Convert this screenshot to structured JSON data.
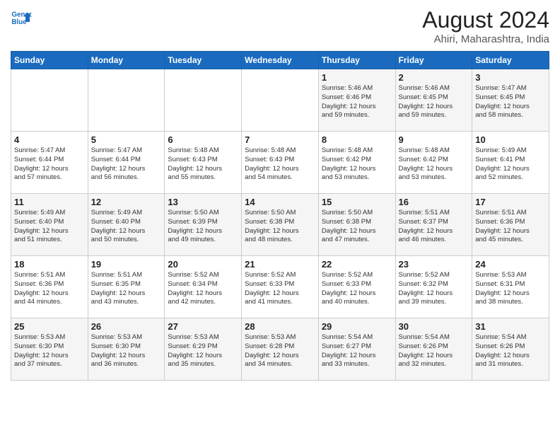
{
  "logo": {
    "line1": "General",
    "line2": "Blue"
  },
  "title": "August 2024",
  "subtitle": "Ahiri, Maharashtra, India",
  "days_of_week": [
    "Sunday",
    "Monday",
    "Tuesday",
    "Wednesday",
    "Thursday",
    "Friday",
    "Saturday"
  ],
  "weeks": [
    [
      {
        "day": "",
        "info": ""
      },
      {
        "day": "",
        "info": ""
      },
      {
        "day": "",
        "info": ""
      },
      {
        "day": "",
        "info": ""
      },
      {
        "day": "1",
        "info": "Sunrise: 5:46 AM\nSunset: 6:46 PM\nDaylight: 12 hours\nand 59 minutes."
      },
      {
        "day": "2",
        "info": "Sunrise: 5:46 AM\nSunset: 6:45 PM\nDaylight: 12 hours\nand 59 minutes."
      },
      {
        "day": "3",
        "info": "Sunrise: 5:47 AM\nSunset: 6:45 PM\nDaylight: 12 hours\nand 58 minutes."
      }
    ],
    [
      {
        "day": "4",
        "info": "Sunrise: 5:47 AM\nSunset: 6:44 PM\nDaylight: 12 hours\nand 57 minutes."
      },
      {
        "day": "5",
        "info": "Sunrise: 5:47 AM\nSunset: 6:44 PM\nDaylight: 12 hours\nand 56 minutes."
      },
      {
        "day": "6",
        "info": "Sunrise: 5:48 AM\nSunset: 6:43 PM\nDaylight: 12 hours\nand 55 minutes."
      },
      {
        "day": "7",
        "info": "Sunrise: 5:48 AM\nSunset: 6:43 PM\nDaylight: 12 hours\nand 54 minutes."
      },
      {
        "day": "8",
        "info": "Sunrise: 5:48 AM\nSunset: 6:42 PM\nDaylight: 12 hours\nand 53 minutes."
      },
      {
        "day": "9",
        "info": "Sunrise: 5:48 AM\nSunset: 6:42 PM\nDaylight: 12 hours\nand 53 minutes."
      },
      {
        "day": "10",
        "info": "Sunrise: 5:49 AM\nSunset: 6:41 PM\nDaylight: 12 hours\nand 52 minutes."
      }
    ],
    [
      {
        "day": "11",
        "info": "Sunrise: 5:49 AM\nSunset: 6:40 PM\nDaylight: 12 hours\nand 51 minutes."
      },
      {
        "day": "12",
        "info": "Sunrise: 5:49 AM\nSunset: 6:40 PM\nDaylight: 12 hours\nand 50 minutes."
      },
      {
        "day": "13",
        "info": "Sunrise: 5:50 AM\nSunset: 6:39 PM\nDaylight: 12 hours\nand 49 minutes."
      },
      {
        "day": "14",
        "info": "Sunrise: 5:50 AM\nSunset: 6:38 PM\nDaylight: 12 hours\nand 48 minutes."
      },
      {
        "day": "15",
        "info": "Sunrise: 5:50 AM\nSunset: 6:38 PM\nDaylight: 12 hours\nand 47 minutes."
      },
      {
        "day": "16",
        "info": "Sunrise: 5:51 AM\nSunset: 6:37 PM\nDaylight: 12 hours\nand 46 minutes."
      },
      {
        "day": "17",
        "info": "Sunrise: 5:51 AM\nSunset: 6:36 PM\nDaylight: 12 hours\nand 45 minutes."
      }
    ],
    [
      {
        "day": "18",
        "info": "Sunrise: 5:51 AM\nSunset: 6:36 PM\nDaylight: 12 hours\nand 44 minutes."
      },
      {
        "day": "19",
        "info": "Sunrise: 5:51 AM\nSunset: 6:35 PM\nDaylight: 12 hours\nand 43 minutes."
      },
      {
        "day": "20",
        "info": "Sunrise: 5:52 AM\nSunset: 6:34 PM\nDaylight: 12 hours\nand 42 minutes."
      },
      {
        "day": "21",
        "info": "Sunrise: 5:52 AM\nSunset: 6:33 PM\nDaylight: 12 hours\nand 41 minutes."
      },
      {
        "day": "22",
        "info": "Sunrise: 5:52 AM\nSunset: 6:33 PM\nDaylight: 12 hours\nand 40 minutes."
      },
      {
        "day": "23",
        "info": "Sunrise: 5:52 AM\nSunset: 6:32 PM\nDaylight: 12 hours\nand 39 minutes."
      },
      {
        "day": "24",
        "info": "Sunrise: 5:53 AM\nSunset: 6:31 PM\nDaylight: 12 hours\nand 38 minutes."
      }
    ],
    [
      {
        "day": "25",
        "info": "Sunrise: 5:53 AM\nSunset: 6:30 PM\nDaylight: 12 hours\nand 37 minutes."
      },
      {
        "day": "26",
        "info": "Sunrise: 5:53 AM\nSunset: 6:30 PM\nDaylight: 12 hours\nand 36 minutes."
      },
      {
        "day": "27",
        "info": "Sunrise: 5:53 AM\nSunset: 6:29 PM\nDaylight: 12 hours\nand 35 minutes."
      },
      {
        "day": "28",
        "info": "Sunrise: 5:53 AM\nSunset: 6:28 PM\nDaylight: 12 hours\nand 34 minutes."
      },
      {
        "day": "29",
        "info": "Sunrise: 5:54 AM\nSunset: 6:27 PM\nDaylight: 12 hours\nand 33 minutes."
      },
      {
        "day": "30",
        "info": "Sunrise: 5:54 AM\nSunset: 6:26 PM\nDaylight: 12 hours\nand 32 minutes."
      },
      {
        "day": "31",
        "info": "Sunrise: 5:54 AM\nSunset: 6:26 PM\nDaylight: 12 hours\nand 31 minutes."
      }
    ]
  ]
}
